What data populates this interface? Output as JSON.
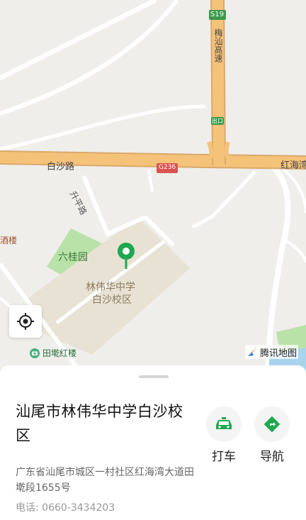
{
  "map": {
    "labels": {
      "highway_shield": "S19",
      "highway_name": "梅汕高速",
      "exit": "出口",
      "road_main": "白沙路",
      "road_shield": "G236",
      "road_east": "红海湾",
      "road_side": "升平路",
      "park": "六桂园",
      "poi_left": "酒楼",
      "school_line1": "林伟华中学",
      "school_line2": "白沙校区",
      "poi_bottom": "田墘红楼"
    },
    "brand": "腾讯地图",
    "colors": {
      "background": "#efeeeb",
      "highway": "#f5c27a",
      "park": "#b9e2a8",
      "campus": "#e8e2d4",
      "pin": "#1fa84f",
      "water": "#a9d4ee"
    }
  },
  "sheet": {
    "title": "汕尾市林伟华中学白沙校区",
    "actions": [
      {
        "label": "打车",
        "icon": "taxi-icon"
      },
      {
        "label": "导航",
        "icon": "navigation-icon"
      }
    ],
    "address": "广东省汕尾市城区一村社区红海湾大道田墘段1655号",
    "phone": "电话: 0660-3434203"
  }
}
